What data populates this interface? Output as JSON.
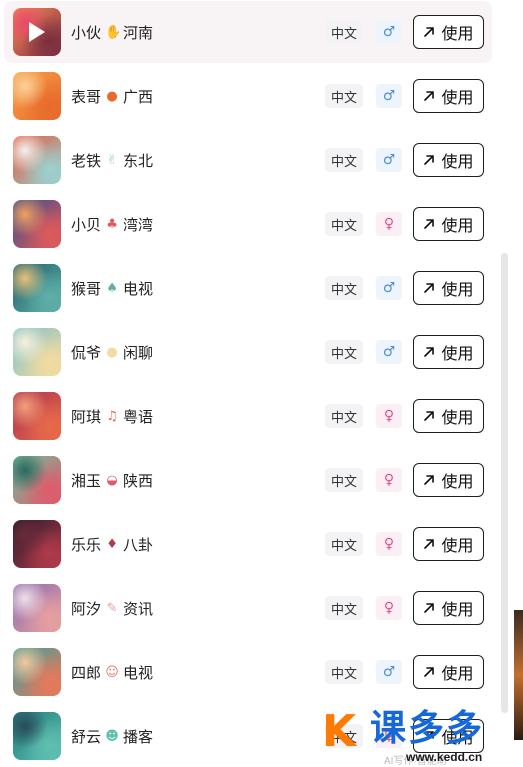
{
  "voices": [
    {
      "name": "小伙",
      "emoji": "✋",
      "tag": "河南",
      "lang": "中文",
      "gender": "♂",
      "gender_type": "male",
      "button": "使用",
      "thumb": [
        "#ff8a5c",
        "#7b2e3e",
        "#e84a6a"
      ],
      "active": true
    },
    {
      "name": "表哥",
      "emoji": "●",
      "tag": "广西",
      "lang": "中文",
      "gender": "♂",
      "gender_type": "male",
      "button": "使用",
      "thumb": [
        "#f7a24a",
        "#e86a2c",
        "#fbd09a"
      ]
    },
    {
      "name": "老铁",
      "emoji": "✌",
      "tag": "东北",
      "lang": "中文",
      "gender": "♂",
      "gender_type": "male",
      "button": "使用",
      "thumb": [
        "#e4553a",
        "#9ad2d0",
        "#f2f2ee"
      ]
    },
    {
      "name": "小贝",
      "emoji": "♣",
      "tag": "湾湾",
      "lang": "中文",
      "gender": "♀",
      "gender_type": "female",
      "button": "使用",
      "thumb": [
        "#3b4d8c",
        "#e05a5a",
        "#f0a060"
      ]
    },
    {
      "name": "猴哥",
      "emoji": "♠",
      "tag": "电视",
      "lang": "中文",
      "gender": "♂",
      "gender_type": "male",
      "button": "使用",
      "thumb": [
        "#1f5f6a",
        "#5fb0a8",
        "#e7c07a"
      ]
    },
    {
      "name": "侃爷",
      "emoji": "●",
      "tag": "闲聊",
      "lang": "中文",
      "gender": "♂",
      "gender_type": "male",
      "button": "使用",
      "thumb": [
        "#7fc0c9",
        "#f3dca0",
        "#f6f1dc"
      ]
    },
    {
      "name": "阿琪",
      "emoji": "♫",
      "tag": "粤语",
      "lang": "中文",
      "gender": "♀",
      "gender_type": "female",
      "button": "使用",
      "thumb": [
        "#a83050",
        "#e86a4a",
        "#f3a07a"
      ]
    },
    {
      "name": "湘玉",
      "emoji": "◒",
      "tag": "陕西",
      "lang": "中文",
      "gender": "♀",
      "gender_type": "female",
      "button": "使用",
      "thumb": [
        "#6fc0a0",
        "#e05a6a",
        "#2a6a60"
      ]
    },
    {
      "name": "乐乐",
      "emoji": "♦",
      "tag": "八卦",
      "lang": "中文",
      "gender": "♀",
      "gender_type": "female",
      "button": "使用",
      "thumb": [
        "#2a1a2a",
        "#b03a4a",
        "#6a2a3a"
      ]
    },
    {
      "name": "阿汐",
      "emoji": "✎",
      "tag": "资讯",
      "lang": "中文",
      "gender": "♀",
      "gender_type": "female",
      "button": "使用",
      "thumb": [
        "#8a6ab0",
        "#e7a0a0",
        "#f0e0ea"
      ]
    },
    {
      "name": "四郎",
      "emoji": "☺",
      "tag": "电视",
      "lang": "中文",
      "gender": "♂",
      "gender_type": "male",
      "button": "使用",
      "thumb": [
        "#3fa09a",
        "#e8785a",
        "#f2c8a0"
      ]
    },
    {
      "name": "舒云",
      "emoji": "☻",
      "tag": "播客",
      "lang": "中文",
      "gender": "♀",
      "gender_type": "female",
      "button": "使用",
      "thumb": [
        "#1f7a7a",
        "#5fc0b0",
        "#2a4a5a"
      ]
    }
  ],
  "watermark": {
    "logo_letter": "K",
    "brand": "课多多",
    "url": "www.kedd.cn",
    "mid_text": "AI写作·智能助"
  },
  "icons": {
    "play": "play-icon",
    "arrow": "arrow-up-right-icon"
  }
}
